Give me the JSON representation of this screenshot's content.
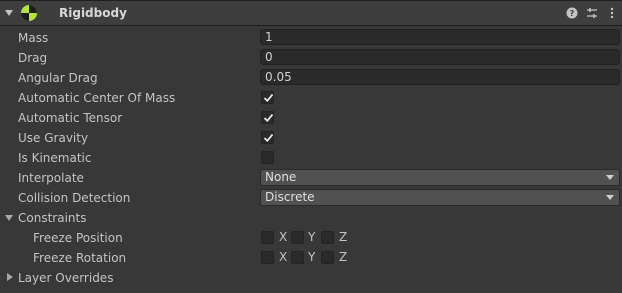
{
  "component": {
    "title": "Rigidbody",
    "icons": {
      "help": "help-icon",
      "preset": "preset-icon",
      "menu": "kebab-menu-icon",
      "component": "rigidbody-icon"
    }
  },
  "properties": {
    "mass": {
      "label": "Mass",
      "value": "1"
    },
    "drag": {
      "label": "Drag",
      "value": "0"
    },
    "angular_drag": {
      "label": "Angular Drag",
      "value": "0.05"
    },
    "auto_center_of_mass": {
      "label": "Automatic Center Of Mass",
      "checked": true
    },
    "auto_tensor": {
      "label": "Automatic Tensor",
      "checked": true
    },
    "use_gravity": {
      "label": "Use Gravity",
      "checked": true
    },
    "is_kinematic": {
      "label": "Is Kinematic",
      "checked": false
    },
    "interpolate": {
      "label": "Interpolate",
      "value": "None"
    },
    "collision_detection": {
      "label": "Collision Detection",
      "value": "Discrete"
    }
  },
  "constraints": {
    "label": "Constraints",
    "freeze_position": {
      "label": "Freeze Position",
      "x": "X",
      "y": "Y",
      "z": "Z"
    },
    "freeze_rotation": {
      "label": "Freeze Rotation",
      "x": "X",
      "y": "Y",
      "z": "Z"
    }
  },
  "layer_overrides": {
    "label": "Layer Overrides"
  },
  "colors": {
    "background": "#383838",
    "header": "#3e3e3e",
    "field": "#2a2a2a",
    "accent": "#b4e43c"
  }
}
